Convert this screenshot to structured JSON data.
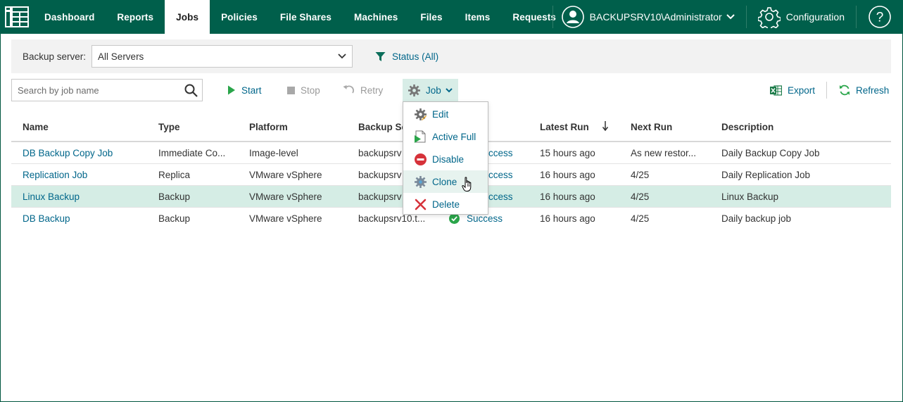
{
  "nav": {
    "tabs": [
      {
        "label": "Dashboard",
        "active": false
      },
      {
        "label": "Reports",
        "active": false
      },
      {
        "label": "Jobs",
        "active": true
      },
      {
        "label": "Policies",
        "active": false
      },
      {
        "label": "File Shares",
        "active": false
      },
      {
        "label": "Machines",
        "active": false
      },
      {
        "label": "Files",
        "active": false
      },
      {
        "label": "Items",
        "active": false
      },
      {
        "label": "Requests",
        "active": false
      }
    ],
    "user": "BACKUPSRV10\\Administrator",
    "configuration": "Configuration",
    "help_icon": "help-icon"
  },
  "filter": {
    "server_label": "Backup server:",
    "server_value": "All Servers",
    "status_label": "Status (All)"
  },
  "toolbar": {
    "search_placeholder": "Search by job name",
    "start": "Start",
    "stop": "Stop",
    "retry": "Retry",
    "job": "Job",
    "export": "Export",
    "refresh": "Refresh"
  },
  "table": {
    "columns": {
      "name": "Name",
      "type": "Type",
      "platform": "Platform",
      "backup_server": "Backup Se",
      "latest_run": "Latest Run",
      "next_run": "Next Run",
      "description": "Description"
    },
    "rows": [
      {
        "name": "DB Backup Copy Job",
        "type": "Immediate Co...",
        "platform": "Image-level",
        "server": "backupsrv",
        "status": "ccess",
        "latest": "15 hours ago",
        "next": "As new restor...",
        "desc": "Daily Backup Copy Job",
        "selected": false
      },
      {
        "name": "Replication Job",
        "type": "Replica",
        "platform": "VMware vSphere",
        "server": "backupsrv",
        "status": "ccess",
        "latest": "16 hours ago",
        "next": "4/25",
        "desc": "Daily Replication Job",
        "selected": false
      },
      {
        "name": "Linux Backup",
        "type": "Backup",
        "platform": "VMware vSphere",
        "server": "backupsrv",
        "status": "ccess",
        "latest": "16 hours ago",
        "next": "4/25",
        "desc": "Linux Backup",
        "selected": true
      },
      {
        "name": "DB Backup",
        "type": "Backup",
        "platform": "VMware vSphere",
        "server": "backupsrv10.t...",
        "status": "Success",
        "latest": "16 hours ago",
        "next": "4/25",
        "desc": "Daily backup job",
        "selected": false
      }
    ]
  },
  "job_menu": {
    "items": [
      {
        "label": "Edit",
        "icon": "edit-gear-icon"
      },
      {
        "label": "Active Full",
        "icon": "active-full-icon"
      },
      {
        "label": "Disable",
        "icon": "disable-icon"
      },
      {
        "label": "Clone",
        "icon": "clone-icon"
      },
      {
        "label": "Delete",
        "icon": "delete-icon"
      }
    ]
  },
  "colors": {
    "brand": "#005f4b",
    "link": "#00668a",
    "selected_row": "#d5ede5",
    "success": "#2aa54a",
    "danger": "#d6323a"
  }
}
